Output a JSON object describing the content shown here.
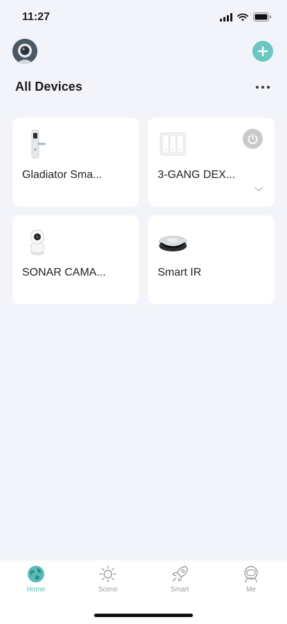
{
  "status_bar": {
    "time": "11:27",
    "icons": [
      "cellular-signal-icon",
      "wifi-icon",
      "battery-icon"
    ]
  },
  "header": {
    "avatar_icon": "astronaut-avatar-icon",
    "add_icon": "plus-icon",
    "title": "All Devices",
    "more_icon": "more-horizontal-icon"
  },
  "devices": [
    {
      "name": "Gladiator Sma...",
      "icon": "smart-lock-icon"
    },
    {
      "name": "3-GANG DEX...",
      "icon": "wall-switch-icon",
      "power_icon": "power-icon",
      "expand_icon": "chevron-down-icon"
    },
    {
      "name": "SONAR CAMA...",
      "icon": "security-camera-icon"
    },
    {
      "name": "Smart IR",
      "icon": "ir-remote-hub-icon"
    }
  ],
  "tab_bar": {
    "tabs": [
      {
        "label": "Home",
        "icon": "globe-icon",
        "active": true
      },
      {
        "label": "Scene",
        "icon": "sun-icon",
        "active": false
      },
      {
        "label": "Smart",
        "icon": "rocket-icon",
        "active": false
      },
      {
        "label": "Me",
        "icon": "astronaut-icon",
        "active": false
      }
    ]
  },
  "colors": {
    "accent": "#5bbab6",
    "add_button": "#6cc7c3",
    "background": "#f2f4f9",
    "card": "#ffffff",
    "inactive_tab": "#9a9a9a"
  }
}
